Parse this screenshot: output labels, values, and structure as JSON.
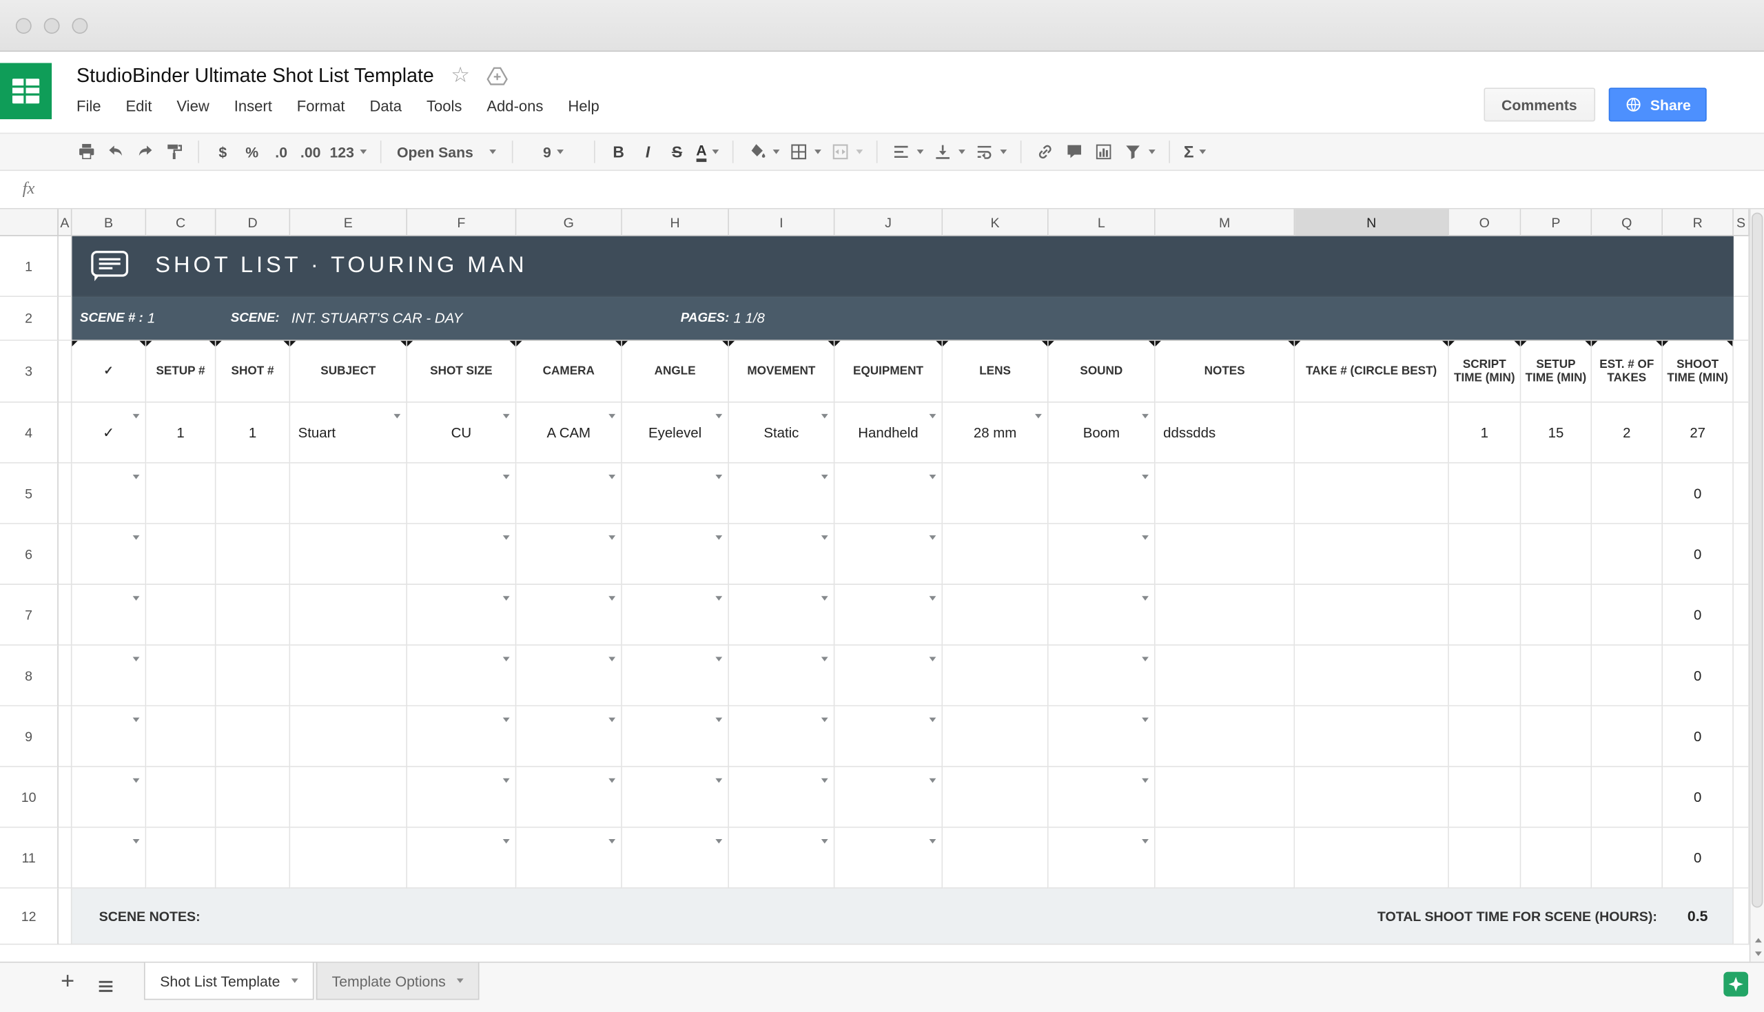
{
  "header": {
    "doc_title": "StudioBinder Ultimate Shot List Template",
    "menus": [
      "File",
      "Edit",
      "View",
      "Insert",
      "Format",
      "Data",
      "Tools",
      "Add-ons",
      "Help"
    ],
    "comments_button": "Comments",
    "share_button": "Share"
  },
  "toolbar": {
    "currency": "$",
    "percent": "%",
    "dec_decrease": ".0",
    "dec_increase": ".00",
    "more_formats": "123",
    "font_name": "Open Sans",
    "font_size": "9",
    "bold": "B",
    "italic": "I",
    "strikethrough": "S",
    "text_color": "A",
    "sum": "Σ"
  },
  "formula_bar": {
    "fx_label": "fx"
  },
  "grid": {
    "column_letters": [
      "A",
      "B",
      "C",
      "D",
      "E",
      "F",
      "G",
      "H",
      "I",
      "J",
      "K",
      "L",
      "M",
      "N",
      "O",
      "P",
      "Q",
      "R",
      "S"
    ],
    "selected_column": "N",
    "row_numbers": [
      "1",
      "2",
      "3",
      "4",
      "5",
      "6",
      "7",
      "8",
      "9",
      "10",
      "11",
      "12"
    ]
  },
  "sheet": {
    "banner": {
      "title": "SHOT LIST · TOURING MAN"
    },
    "scene": {
      "scene_num_label": "SCENE # :",
      "scene_num": "1",
      "scene_label": "SCENE:",
      "scene_desc": "INT. STUART'S CAR - DAY",
      "pages_label": "PAGES:",
      "pages_value": "1 1/8"
    },
    "columns": {
      "check": "✓",
      "setup": "SETUP #",
      "shot": "SHOT #",
      "subject": "SUBJECT",
      "shot_size": "SHOT SIZE",
      "camera": "CAMERA",
      "angle": "ANGLE",
      "movement": "MOVEMENT",
      "equipment": "EQUIPMENT",
      "lens": "LENS",
      "sound": "SOUND",
      "notes": "NOTES",
      "take": "TAKE # (CIRCLE BEST)",
      "script_time": "SCRIPT TIME (MIN)",
      "setup_time": "SETUP TIME (MIN)",
      "est_takes": "EST. # OF TAKES",
      "shoot_time": "SHOOT TIME (MIN)"
    },
    "rows": [
      {
        "check": "✓",
        "setup": "1",
        "shot": "1",
        "subject": "Stuart",
        "shot_size": "CU",
        "camera": "A CAM",
        "angle": "Eyelevel",
        "movement": "Static",
        "equipment": "Handheld",
        "lens": "28 mm",
        "sound": "Boom",
        "notes": "ddssdds",
        "take": "",
        "script_time": "1",
        "setup_time": "15",
        "est_takes": "2",
        "shoot_time": "27"
      },
      {
        "shoot_time": "0"
      },
      {
        "shoot_time": "0"
      },
      {
        "shoot_time": "0"
      },
      {
        "shoot_time": "0"
      },
      {
        "shoot_time": "0"
      },
      {
        "shoot_time": "0"
      },
      {
        "shoot_time": "0"
      }
    ],
    "footer": {
      "notes_label": "SCENE NOTES:",
      "total_label": "TOTAL SHOOT TIME FOR SCENE (HOURS):",
      "total_value": "0.5"
    }
  },
  "tabs": {
    "items": [
      {
        "label": "Shot List Template"
      },
      {
        "label": "Template Options"
      }
    ]
  }
}
